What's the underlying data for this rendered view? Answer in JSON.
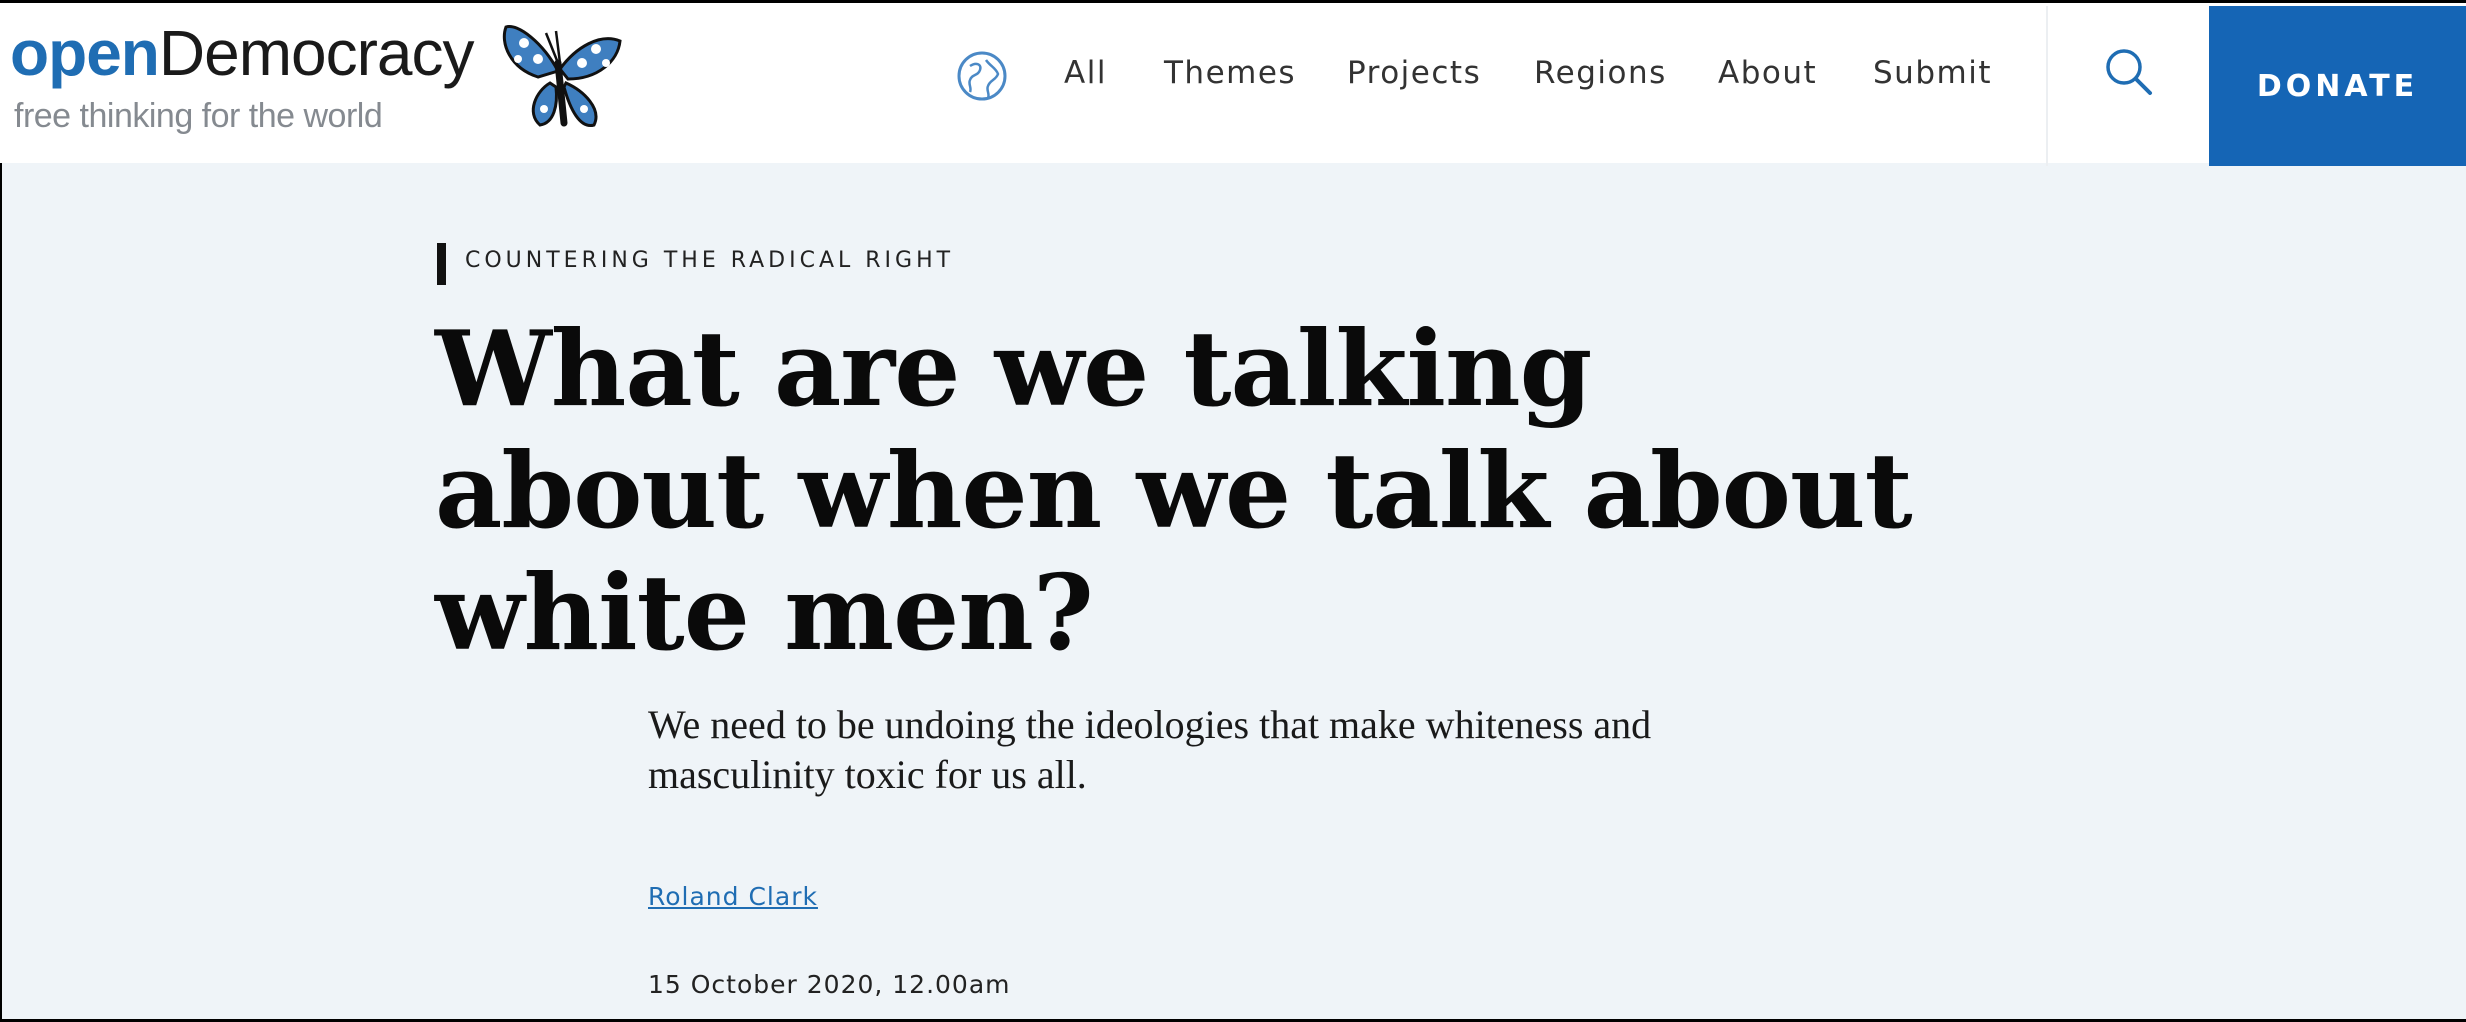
{
  "header": {
    "logo": {
      "primary": "open",
      "secondary": "Democracy",
      "tagline": "free thinking for the world",
      "mascot_icon": "butterfly-icon"
    },
    "nav": [
      "All",
      "Themes",
      "Projects",
      "Regions",
      "About",
      "Submit"
    ],
    "globe_icon": "globe-icon",
    "search_icon": "search-icon",
    "donate_label": "DONATE"
  },
  "article": {
    "kicker": "COUNTERING THE RADICAL RIGHT",
    "headline": "What are we talking about when we talk about white men?",
    "standfirst": "We need to be undoing the ideologies that make whiteness and masculinity toxic for us all.",
    "author": "Roland Clark",
    "date": "15 October 2020, 12.00am"
  },
  "colors": {
    "brand_blue": "#1f6db3",
    "donate_bg": "#1565b5",
    "page_bg": "#eff4f8"
  }
}
